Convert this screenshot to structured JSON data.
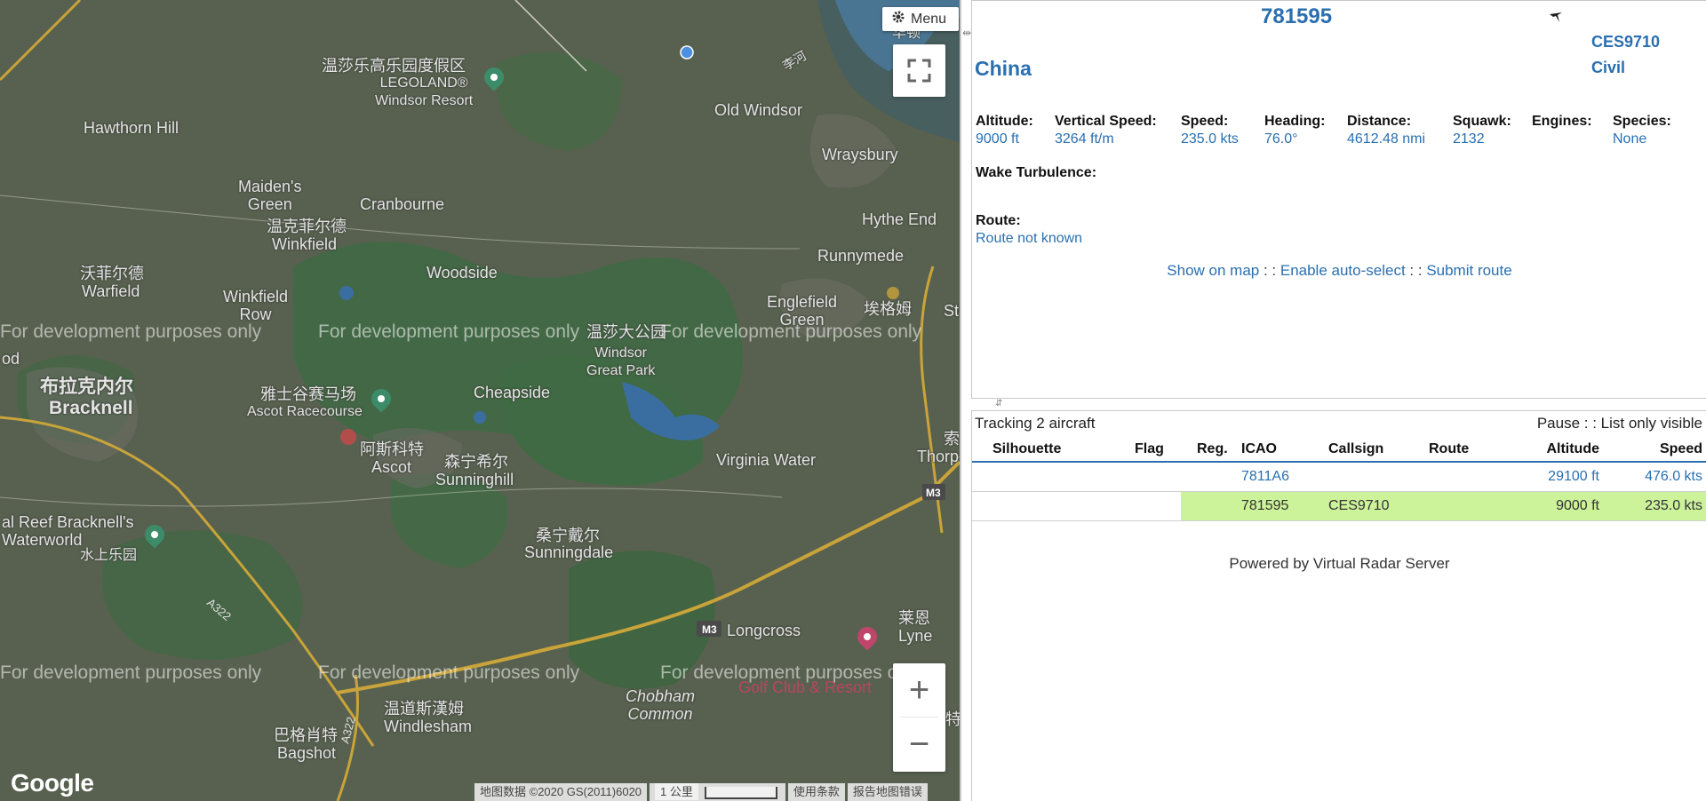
{
  "map": {
    "menu_label": "Menu",
    "watermark": "For development purposes only",
    "google_logo": "Google",
    "attribution": "地图数据 ©2020 GS(2011)6020",
    "scale_label": "1 公里",
    "terms_label": "使用条款",
    "report_label": "报告地图错误",
    "zoom_in": "+",
    "zoom_out": "−",
    "road_labels": [
      "A322",
      "A322",
      "M3",
      "M3"
    ],
    "places": {
      "legoland": "温莎乐高乐园度假区",
      "legoland_en": "LEGOLAND®\nWindsor Resort",
      "old_windsor": "Old Windsor",
      "hawthorn_hill": "Hawthorn Hill",
      "wraysbury": "Wraysbury",
      "maidens_green": "Maiden's\nGreen",
      "cranbourne": "Cranbourne",
      "winkfield_cn": "温克菲尔德",
      "winkfield": "Winkfield",
      "hythe_end": "Hythe End",
      "woodside": "Woodside",
      "runnymede": "Runnymede",
      "warfield_cn": "沃菲尔德",
      "warfield": "Warfield",
      "winkfield_row": "Winkfield\nRow",
      "englefield": "Englefield\nGreen",
      "egham_cn": "埃格姆",
      "egham": "Egham",
      "staines": "Stai",
      "windsor_park_cn": "温莎大公园",
      "windsor_park": "Windsor\nGreat Park",
      "bracknell_cn": "布拉克内尔",
      "bracknell": "Bracknell",
      "ascot_race_cn": "雅士谷赛马场",
      "ascot_race": "Ascot Racecourse",
      "cheapside": "Cheapside",
      "ascot_cn": "阿斯科特",
      "ascot": "Ascot",
      "sunninghill_cn": "森宁希尔",
      "sunninghill": "Sunninghill",
      "virginia_water": "Virginia Water",
      "thorpe_cn": "索",
      "thorpe": "Thorpe Par",
      "od": "od",
      "waterworld": "al Reef Bracknell's\nWaterworld",
      "waterworld_cn": "水上乐园",
      "sunningdale_cn": "桑宁戴尔",
      "sunningdale": "Sunningdale",
      "longcross": "Longcross",
      "lyne_cn": "莱恩",
      "lyne": "Lyne",
      "golf": "Golf Club & Resort",
      "chobham": "Chobham\nCommon",
      "windlesham_cn": "温道斯漢姆",
      "windlesham": "Windlesham",
      "bagshot_cn": "巴格肖特",
      "bagshot": "Bagshot",
      "chert": "特",
      "huamu": "华顿",
      "li": "李河"
    }
  },
  "detail": {
    "icao": "781595",
    "callsign": "CES9710",
    "country": "China",
    "species_category": "Civil",
    "fields": [
      {
        "label": "Altitude:",
        "value": "9000 ft"
      },
      {
        "label": "Vertical Speed:",
        "value": "3264 ft/m"
      },
      {
        "label": "Speed:",
        "value": "235.0 kts"
      },
      {
        "label": "Heading:",
        "value": "76.0°"
      },
      {
        "label": "Distance:",
        "value": "4612.48 nmi"
      },
      {
        "label": "Squawk:",
        "value": "2132"
      },
      {
        "label": "Engines:",
        "value": ""
      },
      {
        "label": "Species:",
        "value": "None"
      }
    ],
    "wake_label": "Wake Turbulence:",
    "route_label": "Route:",
    "route_value": "Route not known",
    "links": {
      "show_on_map": "Show on map",
      "enable_auto_select": "Enable auto-select",
      "submit_route": "Submit route",
      "sep": " : : "
    }
  },
  "list": {
    "tracking_text": "Tracking 2 aircraft",
    "pause": "Pause",
    "list_only_visible": "List only visible",
    "sep": " : : ",
    "columns": [
      "Silhouette",
      "Flag",
      "Reg.",
      "ICAO",
      "Callsign",
      "Route",
      "Altitude",
      "Speed"
    ],
    "rows": [
      {
        "silhouette": "",
        "flag": "",
        "reg": "",
        "icao": "7811A6",
        "callsign": "",
        "route": "",
        "altitude": "29100 ft",
        "speed": "476.0 kts"
      },
      {
        "silhouette": "",
        "flag": "",
        "reg": "",
        "icao": "781595",
        "callsign": "CES9710",
        "route": "",
        "altitude": "9000 ft",
        "speed": "235.0 kts"
      }
    ],
    "powered_by": "Powered by Virtual Radar Server"
  },
  "colors": {
    "link_blue": "#2a6fb0",
    "selected_row": "#ccf29a",
    "map_background": "#57604f"
  }
}
